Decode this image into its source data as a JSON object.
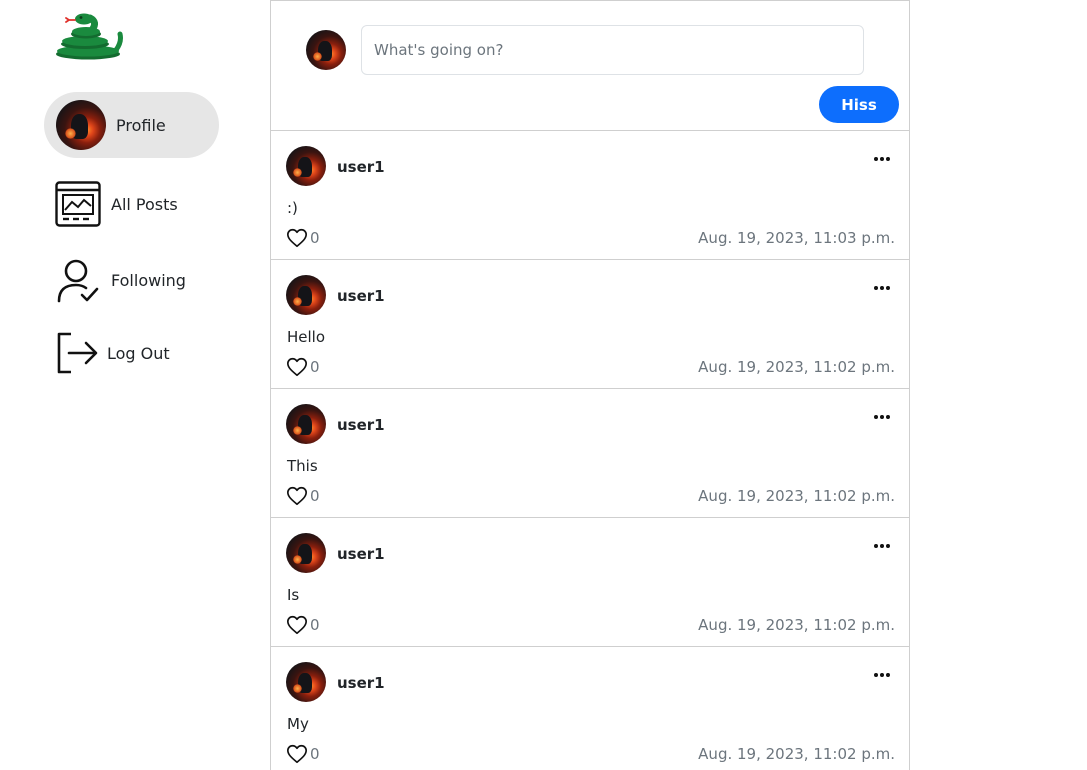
{
  "sidebar": {
    "logo_icon": "snake-logo-icon",
    "items": [
      {
        "label": "Profile",
        "icon": "user-avatar"
      },
      {
        "label": "All Posts",
        "icon": "all-posts-icon"
      },
      {
        "label": "Following",
        "icon": "user-check-icon"
      },
      {
        "label": "Log Out",
        "icon": "logout-icon"
      }
    ]
  },
  "compose": {
    "placeholder": "What's going on?",
    "value": "",
    "submit_label": "Hiss"
  },
  "posts": [
    {
      "user": "user1",
      "content": ":)",
      "likes": "0",
      "timestamp": "Aug. 19, 2023, 11:03 p.m."
    },
    {
      "user": "user1",
      "content": "Hello",
      "likes": "0",
      "timestamp": "Aug. 19, 2023, 11:02 p.m."
    },
    {
      "user": "user1",
      "content": "This",
      "likes": "0",
      "timestamp": "Aug. 19, 2023, 11:02 p.m."
    },
    {
      "user": "user1",
      "content": "Is",
      "likes": "0",
      "timestamp": "Aug. 19, 2023, 11:02 p.m."
    },
    {
      "user": "user1",
      "content": "My",
      "likes": "0",
      "timestamp": "Aug. 19, 2023, 11:02 p.m."
    }
  ],
  "colors": {
    "accent": "#0d6efd",
    "logo": "#1a8a3e",
    "active_nav_bg": "#e6e6e6",
    "muted_text": "#6c757d",
    "border": "#cfcfcf"
  }
}
